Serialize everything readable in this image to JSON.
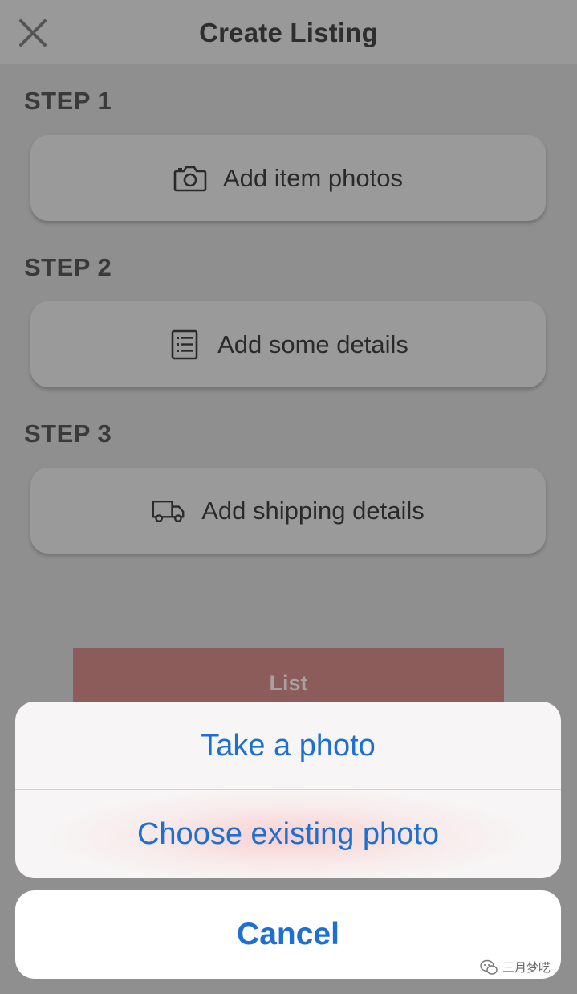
{
  "header": {
    "title": "Create Listing"
  },
  "steps": [
    {
      "label": "STEP 1",
      "action": "Add item photos",
      "icon": "camera-icon"
    },
    {
      "label": "STEP 2",
      "action": "Add some details",
      "icon": "list-icon"
    },
    {
      "label": "STEP 3",
      "action": "Add shipping details",
      "icon": "truck-icon"
    }
  ],
  "list_button": {
    "label": "List"
  },
  "action_sheet": {
    "options": [
      "Take a photo",
      "Choose existing photo"
    ],
    "cancel": "Cancel"
  },
  "watermark": {
    "text": "三月梦呓"
  },
  "colors": {
    "action_blue": "#1d6fd1",
    "list_button": "#8c5c5a"
  }
}
